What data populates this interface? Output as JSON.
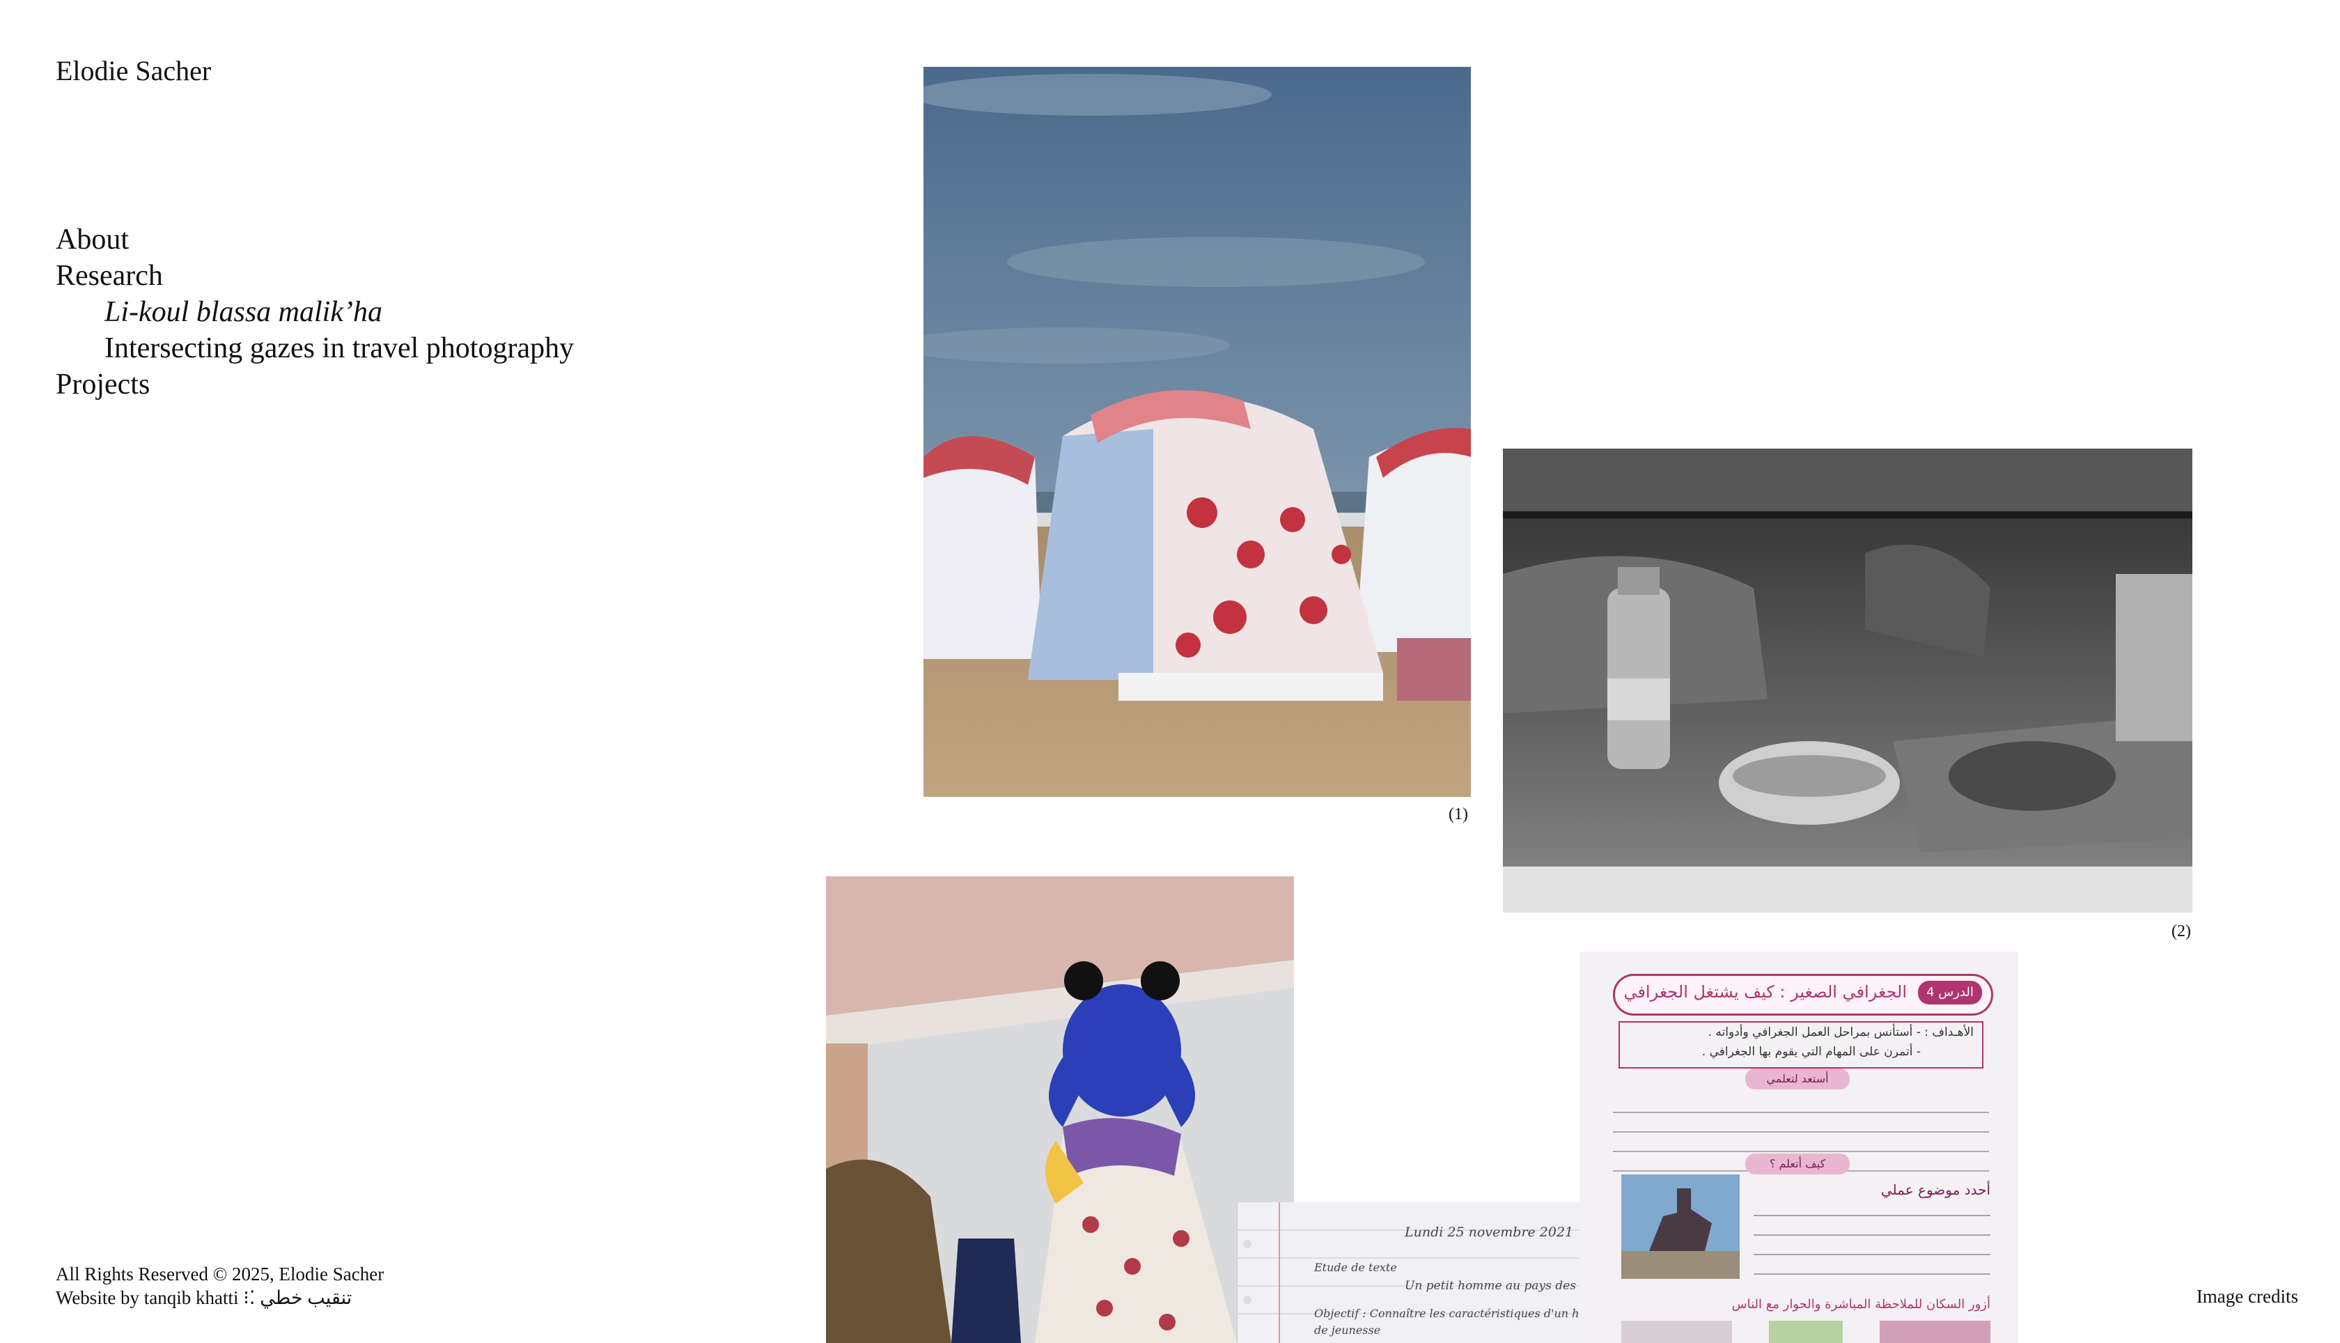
{
  "site": {
    "title": "Elodie Sacher"
  },
  "nav": {
    "items": [
      {
        "label": "About"
      },
      {
        "label": "Research"
      },
      {
        "label": "Li-koul blassa malik’ha"
      },
      {
        "label": "Intersecting gazes in travel photography"
      },
      {
        "label": "Projects"
      }
    ]
  },
  "captions": {
    "one": "(1)",
    "two": "(2)"
  },
  "workbook": {
    "title": "الجغرافي الصغير : كيف يشتغل الجغرافي",
    "lesson": "الدرس 4",
    "goals_line1": "الأهـداف : - أستأنس بمراحل العمل الجغرافي وأدواته .",
    "goals_line2": "- أتمرن على المهام التي يقوم بها الجغرافي .",
    "pill1": "أستعد لتعلمي",
    "pill2": "كيف أتعلم ؟",
    "topic": "أحدد موضوع عملي",
    "bottom": "أزور السكان للملاحظة المباشرة والحوار مع الناس"
  },
  "notebook": {
    "date": "Lundi 25 novembre 2021",
    "heading": "Etude de texte",
    "subtitle": "Un petit homme au pays des loups",
    "objective": "Objectif : Connaître les caractéristiques d'un héros de jeunesse"
  },
  "footer": {
    "rights": "All Rights Reserved © 2025, Elodie Sacher",
    "website": "Website by tanqib khatti ⁝⁚ تنقيب خطي",
    "credits": "Image credits"
  },
  "colors": {
    "sky": "#4f6f8f",
    "sand": "#b99a76",
    "umbrella_red": "#c9505a",
    "workbook_pink": "#b0346e",
    "wig_blue": "#2b3fb8"
  }
}
